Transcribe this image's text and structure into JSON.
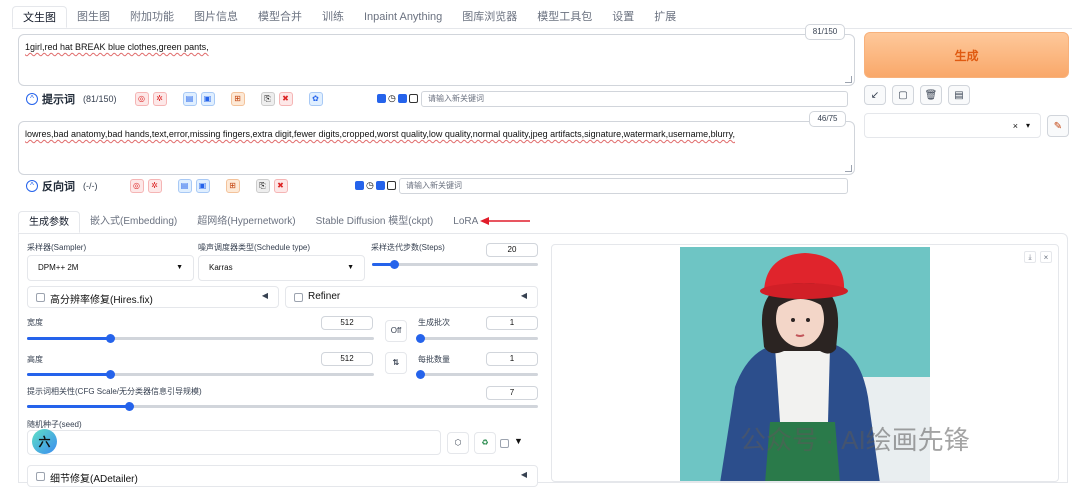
{
  "top_tabs": [
    "文生图",
    "图生图",
    "附加功能",
    "图片信息",
    "模型合并",
    "训练",
    "Inpaint Anything",
    "图库浏览器",
    "模型工具包",
    "设置",
    "扩展"
  ],
  "prompt": {
    "text": "1girl,red hat BREAK blue clothes,green pants,",
    "counter": "81/150",
    "label": "提示词",
    "count_label": "(81/150)",
    "keyword_placeholder": "请输入新关键词"
  },
  "negative": {
    "text": "lowres,bad anatomy,bad hands,text,error,missing fingers,extra digit,fewer digits,cropped,worst quality,low quality,normal quality,jpeg artifacts,signature,watermark,username,blurry,",
    "counter": "46/75",
    "label": "反向词",
    "count_label": "(-/-)",
    "keyword_placeholder": "请输入新关键词"
  },
  "generate_label": "生成",
  "style_select": {
    "value": "",
    "clear": "×",
    "arrow": "▾"
  },
  "sub_tabs": [
    "生成参数",
    "嵌入式(Embedding)",
    "超网络(Hypernetwork)",
    "Stable Diffusion 模型(ckpt)",
    "LoRA"
  ],
  "params": {
    "sampler": {
      "label": "采样器(Sampler)",
      "value": "DPM++ 2M"
    },
    "schedule": {
      "label": "噪声调度器类型(Schedule type)",
      "value": "Karras"
    },
    "steps": {
      "label": "采样迭代步数(Steps)",
      "value": "20",
      "fraction": 0.13
    },
    "hires": {
      "label": "高分辨率修复(Hires.fix)"
    },
    "refiner": {
      "label": "Refiner"
    },
    "width": {
      "label": "宽度",
      "value": "512",
      "fraction": 0.24
    },
    "height": {
      "label": "高度",
      "value": "512",
      "fraction": 0.24
    },
    "batch_count": {
      "label": "生成批次",
      "value": "1",
      "fraction": 0.0
    },
    "batch_size": {
      "label": "每批数量",
      "value": "1",
      "fraction": 0.0
    },
    "off_label": "Off",
    "swap_icon": "⇅",
    "cfg": {
      "label": "提示词相关性(CFG Scale/无分类器信息引导规模)",
      "value": "7",
      "fraction": 0.2
    },
    "seed": {
      "label": "随机种子(seed)",
      "value": ""
    },
    "adetailer": {
      "label": "细节修复(ADetailer)"
    }
  },
  "watermark": "公众号 · AI绘画先锋",
  "avatar_char": "六",
  "accent": "#2563eb",
  "generate_color": "#f9a86a"
}
